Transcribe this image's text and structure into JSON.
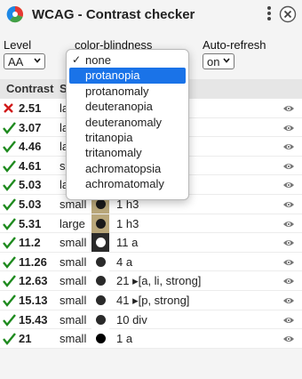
{
  "app": {
    "title": "WCAG - Contrast checker"
  },
  "controls": {
    "level_label": "Level",
    "level_value": "AA",
    "colorblind_label": "color-blindness",
    "autorefresh_label": "Auto-refresh",
    "autorefresh_value": "on"
  },
  "dropdown": {
    "checked": "none",
    "highlighted": "protanopia",
    "options": [
      "none",
      "protanopia",
      "protanomaly",
      "deuteranopia",
      "deuteranomaly",
      "tritanopia",
      "tritanomaly",
      "achromatopsia",
      "achromatomaly"
    ]
  },
  "table": {
    "headers": {
      "contrast": "Contrast",
      "size": "S"
    },
    "rows": [
      {
        "status": "fail",
        "ratio": "2.51",
        "size": "la",
        "info": "",
        "swatch": "",
        "dot": ""
      },
      {
        "status": "pass",
        "ratio": "3.07",
        "size": "la",
        "info": ", h2, h3]",
        "swatch": "",
        "dot": ""
      },
      {
        "status": "pass",
        "ratio": "4.46",
        "size": "la",
        "info": "",
        "swatch": "",
        "dot": ""
      },
      {
        "status": "pass",
        "ratio": "4.61",
        "size": "su",
        "info": "]",
        "swatch": "",
        "dot": ""
      },
      {
        "status": "pass",
        "ratio": "5.03",
        "size": "la",
        "info": "",
        "swatch": "",
        "dot": ""
      },
      {
        "status": "pass",
        "ratio": "5.03",
        "size": "small",
        "info": "1 h3",
        "swatch": "#b9a77a",
        "dot": "#1a1a1a"
      },
      {
        "status": "pass",
        "ratio": "5.31",
        "size": "large",
        "info": "1 h3",
        "swatch": "#b9a77a",
        "dot": "#1a1a1a"
      },
      {
        "status": "pass",
        "ratio": "11.2",
        "size": "small",
        "info": "11 a",
        "swatch": "#2a2a2a",
        "dot": "#ffffff"
      },
      {
        "status": "pass",
        "ratio": "11.26",
        "size": "small",
        "info": "4 a",
        "swatch": "#ffffff",
        "dot": "#2a2a2a"
      },
      {
        "status": "pass",
        "ratio": "12.63",
        "size": "small",
        "info": "21 ▸[a, li, strong]",
        "swatch": "#ffffff",
        "dot": "#2a2a2a"
      },
      {
        "status": "pass",
        "ratio": "15.13",
        "size": "small",
        "info": "41 ▸[p, strong]",
        "swatch": "#ffffff",
        "dot": "#2a2a2a"
      },
      {
        "status": "pass",
        "ratio": "15.43",
        "size": "small",
        "info": "10 div",
        "swatch": "#ffffff",
        "dot": "#2a2a2a"
      },
      {
        "status": "pass",
        "ratio": "21",
        "size": "small",
        "info": "1 a",
        "swatch": "#ffffff",
        "dot": "#000000"
      }
    ]
  },
  "colors": {
    "pass": "#1e8a1e",
    "fail": "#d11a1a",
    "highlight": "#1a73e8"
  },
  "icons": {
    "logo": "color-wheel-icon",
    "menu": "kebab-menu-icon",
    "close": "close-icon",
    "status_pass": "checkmark-icon",
    "status_fail": "cross-icon",
    "row_action": "eye-icon",
    "dropdown_check": "check-icon"
  }
}
